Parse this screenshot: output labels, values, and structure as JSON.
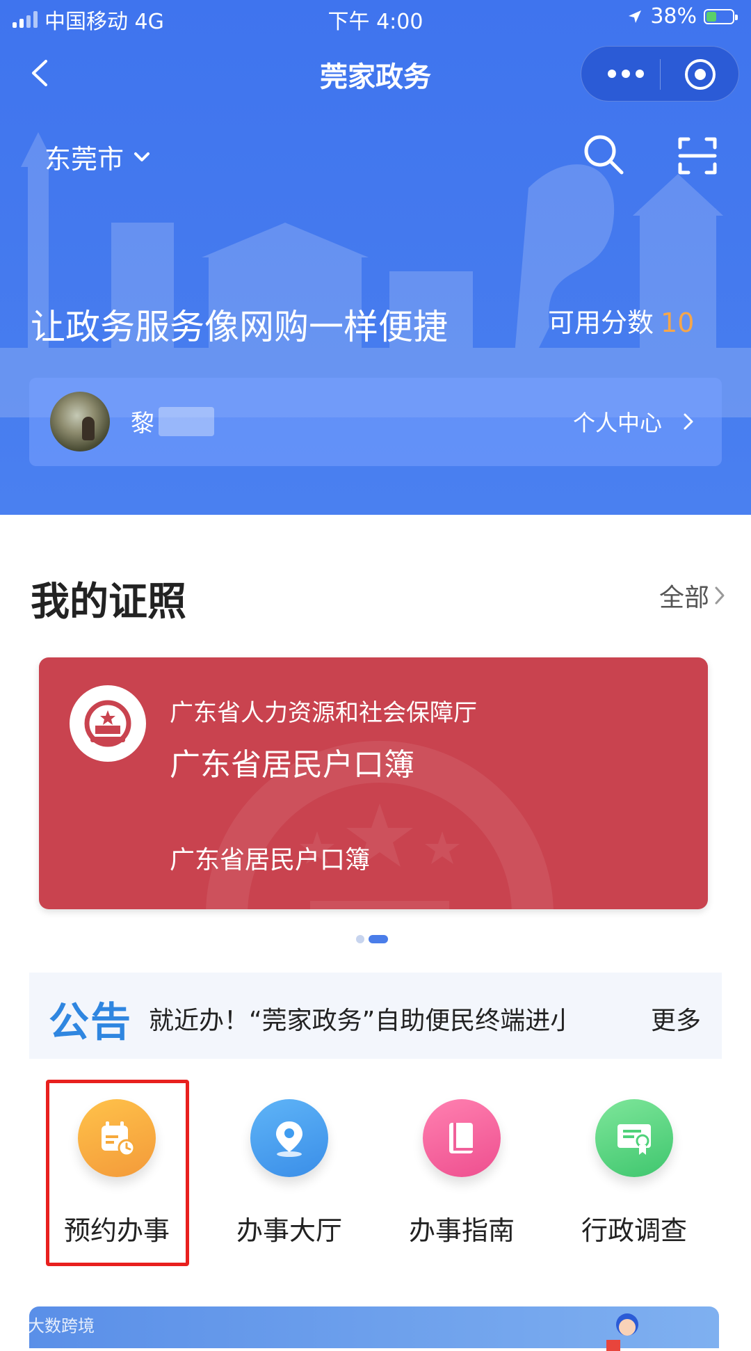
{
  "status_bar": {
    "carrier": "中国移动 4G",
    "time": "下午 4:00",
    "battery": "38%",
    "battery_level": 0.38
  },
  "nav": {
    "title": "莞家政务"
  },
  "header": {
    "city": "东莞市",
    "slogan": "让政务服务像网购一样便捷",
    "score_label": "可用分数",
    "score_value": "10"
  },
  "user": {
    "name_visible": "黎",
    "center_label": "个人中心"
  },
  "licenses": {
    "section_title": "我的证照",
    "all_label": "全部",
    "card": {
      "issuer": "广东省人力资源和社会保障厅",
      "name": "广东省居民户口簿",
      "subtitle": "广东省居民户口簿"
    },
    "carousel_count": 2,
    "carousel_active": 2
  },
  "notice": {
    "tag": "公告",
    "text": "就近办！“莞家政务”自助便民终端进小区…",
    "more": "更多"
  },
  "services": [
    {
      "label": "预约办事",
      "icon": "calendar-icon",
      "color": "#f6a93b"
    },
    {
      "label": "办事大厅",
      "icon": "location-pin-icon",
      "color": "#3f9cf0"
    },
    {
      "label": "办事指南",
      "icon": "book-icon",
      "color": "#f0609a"
    },
    {
      "label": "行政调查",
      "icon": "certificate-icon",
      "color": "#4fd27a"
    }
  ],
  "watermark": "大数跨境",
  "colors": {
    "primary_blue": "#4479ee",
    "card_red": "#c9434f",
    "score_orange": "#f6a64a",
    "highlight_red": "#e8201e"
  }
}
